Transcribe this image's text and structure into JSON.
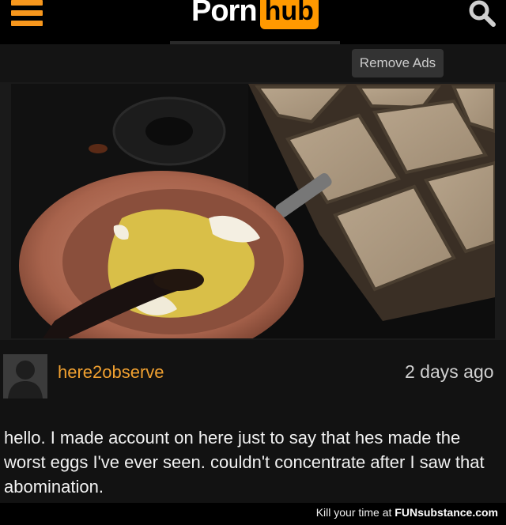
{
  "header": {
    "logo_left": "Porn",
    "logo_right": "hub",
    "remove_ads_label": "Remove Ads"
  },
  "icons": {
    "menu": "hamburger-menu-icon",
    "search": "search-icon",
    "avatar": "default-user-avatar-icon"
  },
  "colors": {
    "accent": "#ff9900",
    "username": "#f0a030",
    "background": "#121212"
  },
  "comment": {
    "username": "here2observe",
    "timestamp": "2 days ago",
    "text": "hello. I made account on here just to say that hes made the worst eggs I've ever seen. couldn't concentrate after I saw that abomination."
  },
  "watermark": {
    "prefix": "Kill your time at",
    "brand": "FUNsubstance.com"
  }
}
